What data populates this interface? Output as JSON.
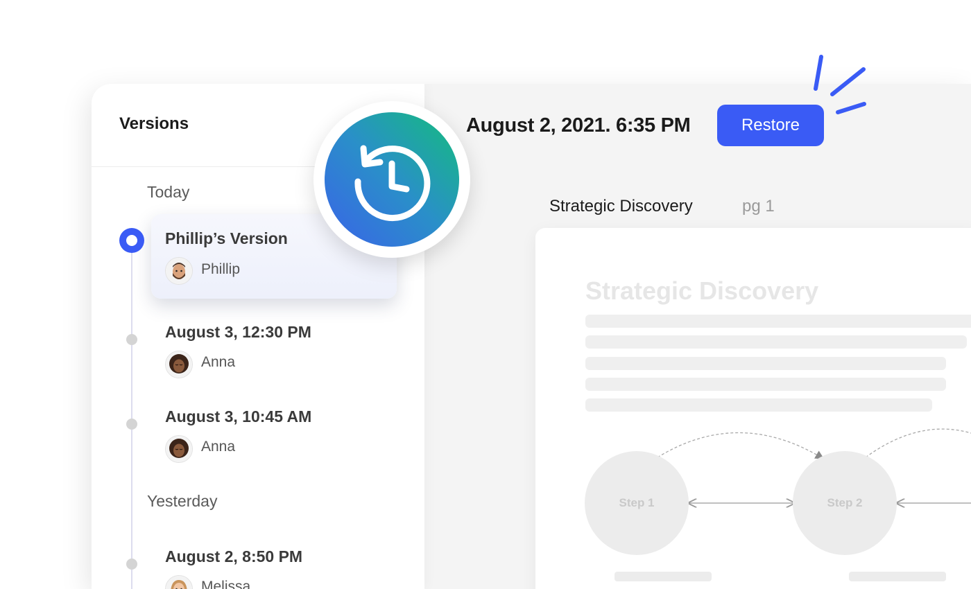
{
  "sidebar": {
    "title": "Versions",
    "groups": [
      {
        "label": "Today"
      },
      {
        "label": "Yesterday"
      }
    ],
    "versions": [
      {
        "title": "Phillip’s Version",
        "author": "Phillip",
        "selected": true
      },
      {
        "title": "August 3, 12:30 PM",
        "author": "Anna"
      },
      {
        "title": "August 3, 10:45 AM",
        "author": "Anna"
      },
      {
        "title": "August 2, 8:50 PM",
        "author": "Melissa"
      }
    ]
  },
  "main": {
    "current_version_date": "August 2, 2021. 6:35 PM",
    "restore_label": "Restore",
    "document_title": "Strategic Discovery",
    "page_indicator": "pg 1",
    "page_heading": "Strategic Discovery",
    "steps": [
      "Step 1",
      "Step 2"
    ]
  },
  "colors": {
    "accent": "#3a5bf5",
    "badge_gradient_start": "#14bd7c",
    "badge_gradient_end": "#3a63e8"
  },
  "icons": {
    "history": "history-clock-icon",
    "sparkle": "sparkle-lines-icon"
  }
}
